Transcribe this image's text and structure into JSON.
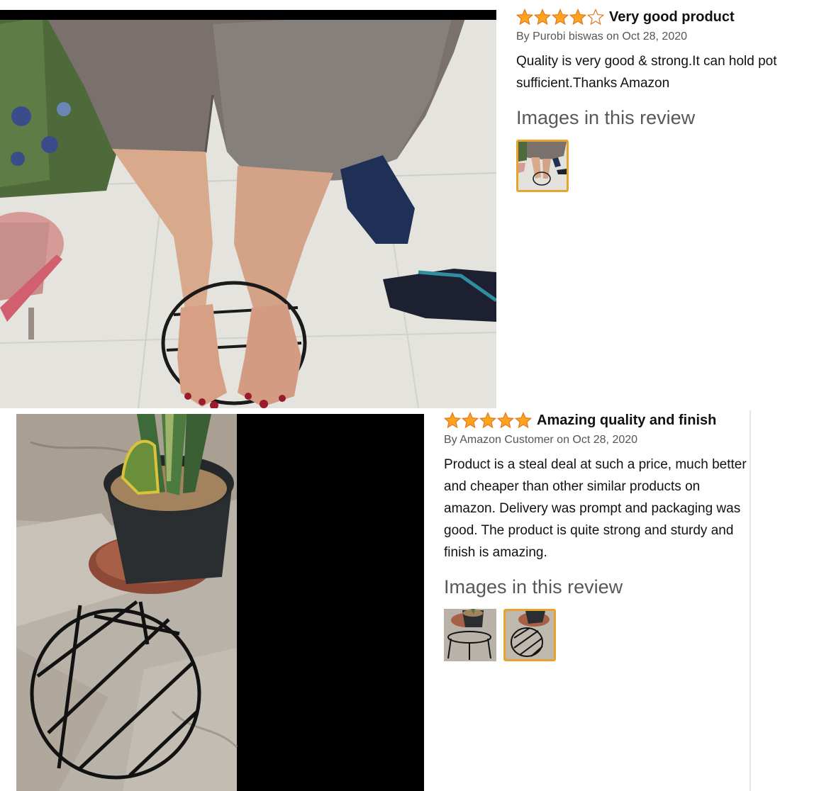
{
  "colors": {
    "star": "#ffa41c",
    "star_outline": "#de7921",
    "thumb_selected": "#e7a42c",
    "byline": "#555555",
    "section_label": "#565959"
  },
  "reviews": [
    {
      "rating": 4,
      "max_rating": 5,
      "title": "Very good product",
      "byline": "By Purobi biswas on Oct 28, 2020",
      "body_lines": [
        "Quality is very good & strong.It can hold pot",
        "sufficient.Thanks Amazon"
      ],
      "images_label": "Images in this review",
      "thumbnails": [
        {
          "icon": "feet-on-stand-thumbnail",
          "selected": true
        }
      ]
    },
    {
      "rating": 5,
      "max_rating": 5,
      "title": "Amazing quality and finish",
      "byline": "By Amazon Customer on Oct 28, 2020",
      "body": "Product is a steal deal at such a price, much better and cheaper than other similar products on amazon. Delivery was prompt and packaging was good. The product is quite strong and sturdy and finish is amazing.",
      "images_label": "Images in this review",
      "thumbnails": [
        {
          "icon": "pot-and-stand-thumbnail",
          "selected": false
        },
        {
          "icon": "stand-closeup-thumbnail",
          "selected": true
        }
      ]
    }
  ]
}
